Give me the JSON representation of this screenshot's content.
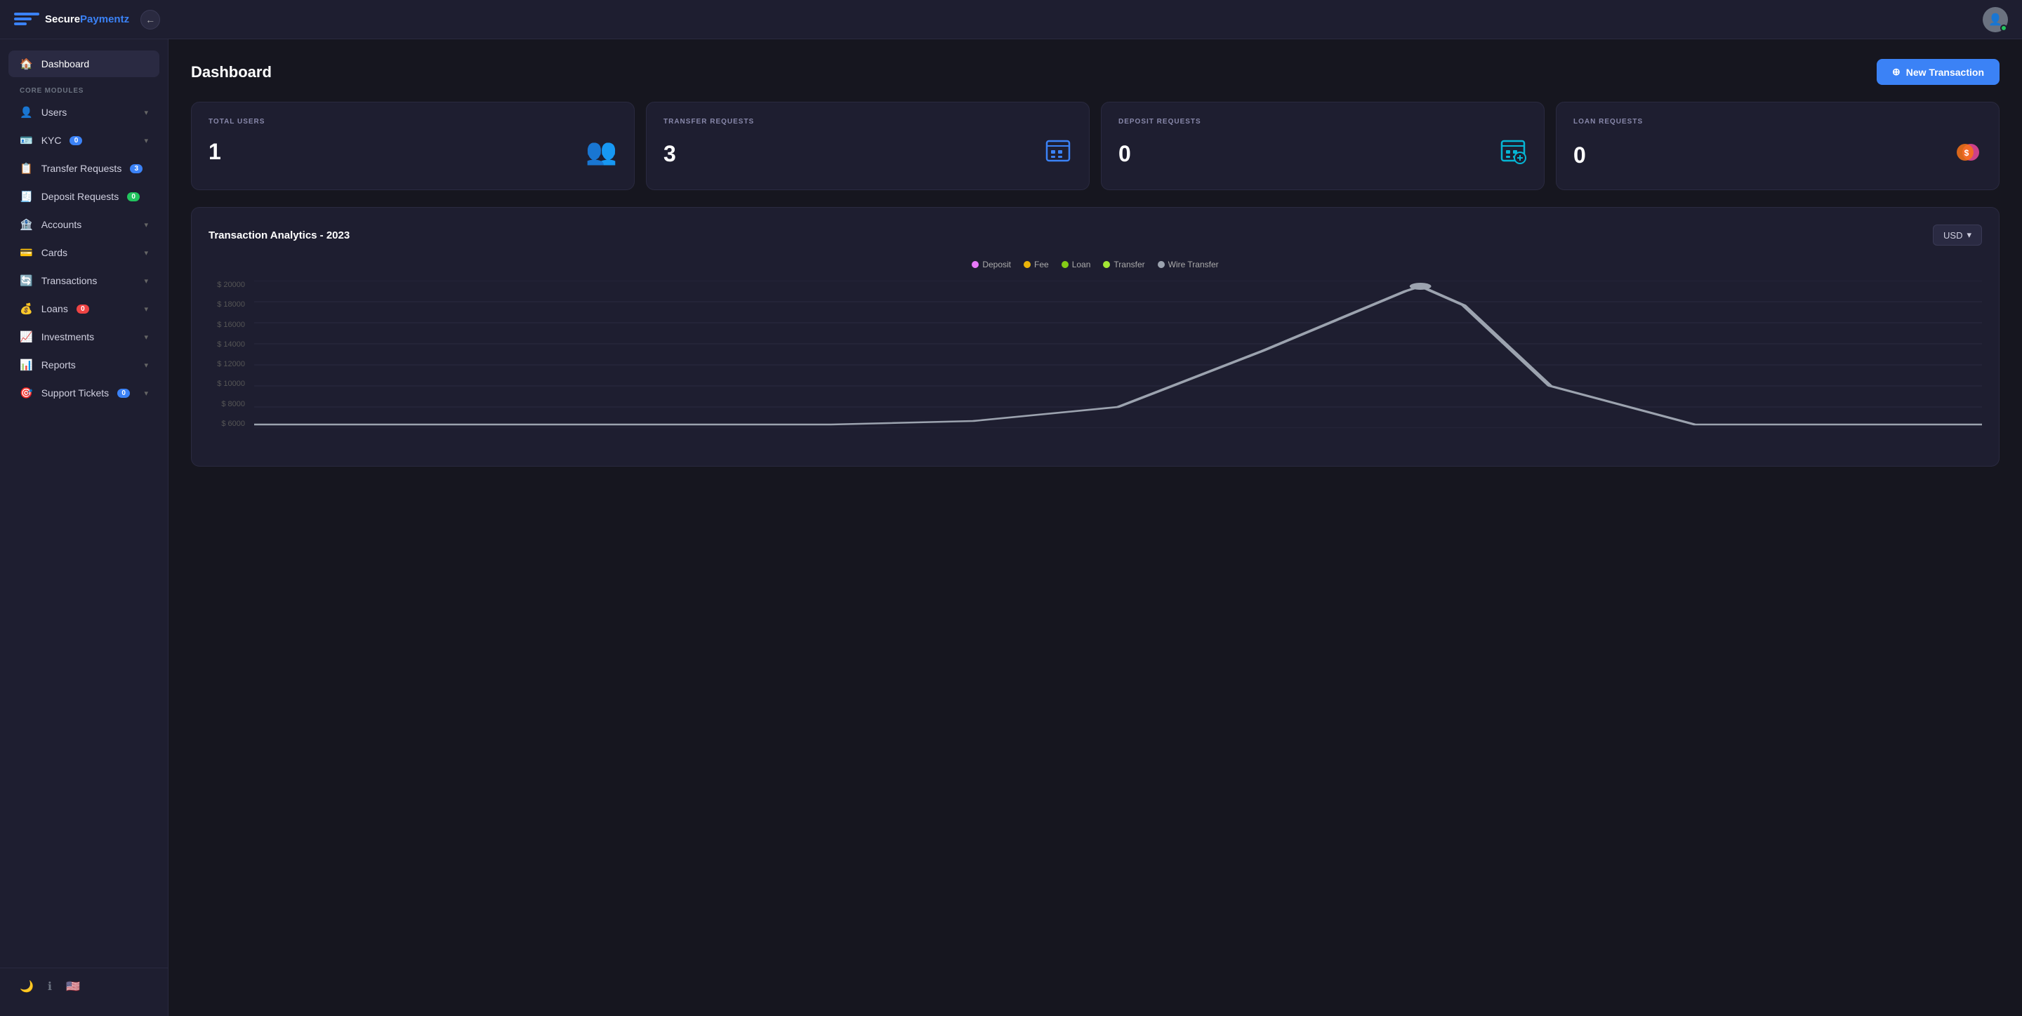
{
  "app": {
    "name_secure": "Secure",
    "name_paymentz": "Paymentz",
    "title": "Dashboard"
  },
  "topbar": {
    "new_transaction_label": "New Transaction"
  },
  "sidebar": {
    "section_label": "CORE MODULES",
    "active_item": "Dashboard",
    "items": [
      {
        "id": "dashboard",
        "label": "Dashboard",
        "icon": "🏠",
        "badge": null,
        "active": true
      },
      {
        "id": "users",
        "label": "Users",
        "icon": "👤",
        "badge": null,
        "chevron": true
      },
      {
        "id": "kyc",
        "label": "KYC",
        "icon": "💳",
        "badge": "0",
        "badge_color": "blue",
        "chevron": true
      },
      {
        "id": "transfer-requests",
        "label": "Transfer Requests",
        "icon": "📋",
        "badge": "3",
        "badge_color": "blue",
        "chevron": false
      },
      {
        "id": "deposit-requests",
        "label": "Deposit Requests",
        "icon": "🧾",
        "badge": "0",
        "badge_color": "green",
        "chevron": false
      },
      {
        "id": "accounts",
        "label": "Accounts",
        "icon": "🏦",
        "badge": null,
        "chevron": true
      },
      {
        "id": "cards",
        "label": "Cards",
        "icon": "💳",
        "badge": null,
        "chevron": true
      },
      {
        "id": "transactions",
        "label": "Transactions",
        "icon": "🔄",
        "badge": null,
        "chevron": true
      },
      {
        "id": "loans",
        "label": "Loans",
        "icon": "💰",
        "badge": "0",
        "badge_color": "red",
        "chevron": true
      },
      {
        "id": "investments",
        "label": "Investments",
        "icon": "📈",
        "badge": null,
        "chevron": true
      },
      {
        "id": "reports",
        "label": "Reports",
        "icon": "📊",
        "badge": null,
        "chevron": true
      },
      {
        "id": "support-tickets",
        "label": "Support Tickets",
        "icon": "🎯",
        "badge": "0",
        "badge_color": "blue",
        "chevron": true
      }
    ]
  },
  "stats": [
    {
      "id": "total-users",
      "label": "TOTAL USERS",
      "value": "1",
      "icon": "👥",
      "icon_class": "teal"
    },
    {
      "id": "transfer-requests",
      "label": "TRANSFER REQUESTS",
      "value": "3",
      "icon": "📱",
      "icon_class": "blue"
    },
    {
      "id": "deposit-requests",
      "label": "DEPOSIT REQUESTS",
      "value": "0",
      "icon": "📲",
      "icon_class": "cyan"
    },
    {
      "id": "loan-requests",
      "label": "LOAN REQUESTS",
      "value": "0",
      "icon": "💲",
      "icon_class": "pink"
    }
  ],
  "analytics": {
    "title": "Transaction Analytics - 2023",
    "currency": "USD",
    "legend": [
      {
        "label": "Deposit",
        "color": "#e879f9"
      },
      {
        "label": "Fee",
        "color": "#eab308"
      },
      {
        "label": "Loan",
        "color": "#84cc16"
      },
      {
        "label": "Transfer",
        "color": "#a3e635"
      },
      {
        "label": "Wire Transfer",
        "color": "#9ca3af"
      }
    ],
    "y_labels": [
      "$ 20000",
      "$ 18000",
      "$ 16000",
      "$ 14000",
      "$ 12000",
      "$ 10000",
      "$ 8000",
      "$ 6000"
    ],
    "wire_transfer_peak": true
  }
}
